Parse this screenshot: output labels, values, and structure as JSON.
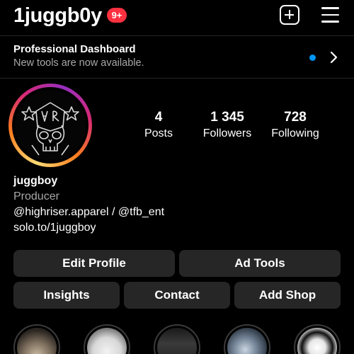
{
  "header": {
    "username": "1juggb0y",
    "notification_badge": "9+"
  },
  "dashboard": {
    "title": "Professional Dashboard",
    "subtitle": "New tools are now available."
  },
  "stats": [
    {
      "value": "4",
      "label": "Posts"
    },
    {
      "value": "1 345",
      "label": "Followers"
    },
    {
      "value": "728",
      "label": "Following"
    }
  ],
  "bio": {
    "name": "juggboy",
    "category": "Producer",
    "mentions": "@highriser.apparel / @tfb_ent",
    "link": "solo.to/1juggboy"
  },
  "buttons": {
    "edit_profile": "Edit Profile",
    "ad_tools": "Ad Tools",
    "insights": "Insights",
    "contact": "Contact",
    "add_shop": "Add Shop"
  },
  "colors": {
    "accent": "#0095f6",
    "badge": "#ff3040",
    "button_bg": "#262626",
    "secondary_text": "#a8a8a8"
  },
  "icons": [
    "plus-square-icon",
    "hamburger-menu-icon",
    "chevron-right-icon",
    "blue-dot-indicator"
  ]
}
